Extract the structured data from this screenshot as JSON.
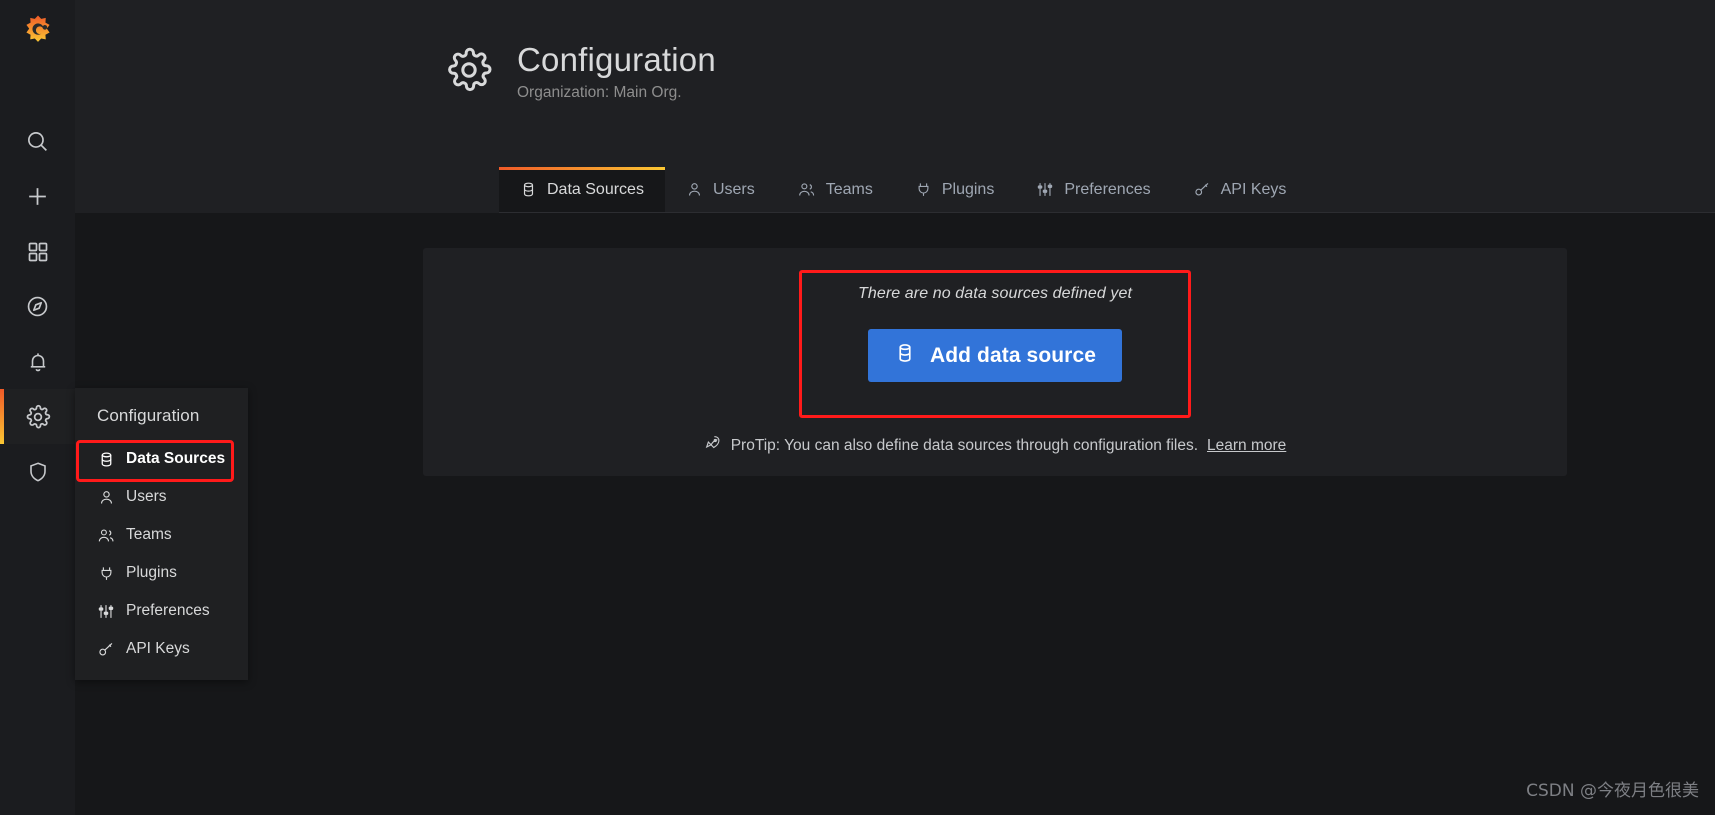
{
  "app": {
    "brand_icon": "grafana-logo-icon",
    "background": "#161719",
    "panel_background": "#1f2023",
    "accent_gradient_start": "#f05a28",
    "accent_gradient_end": "#fbc733",
    "primary_button_color": "#3274d9",
    "highlight_box_color": "#ff1a1a"
  },
  "sidebar": {
    "items": [
      {
        "name": "search-icon",
        "label": "Search",
        "active": false
      },
      {
        "name": "plus-icon",
        "label": "Create",
        "active": false
      },
      {
        "name": "dashboards-icon",
        "label": "Dashboards",
        "active": false
      },
      {
        "name": "compass-icon",
        "label": "Explore",
        "active": false
      },
      {
        "name": "bell-icon",
        "label": "Alerting",
        "active": false
      },
      {
        "name": "gear-icon",
        "label": "Configuration",
        "active": true
      },
      {
        "name": "shield-icon",
        "label": "Server Admin",
        "active": false
      }
    ]
  },
  "flyout": {
    "title": "Configuration",
    "items": [
      {
        "label": "Data Sources",
        "icon": "database-icon",
        "highlighted": true
      },
      {
        "label": "Users",
        "icon": "user-icon",
        "highlighted": false
      },
      {
        "label": "Teams",
        "icon": "users-icon",
        "highlighted": false
      },
      {
        "label": "Plugins",
        "icon": "plug-icon",
        "highlighted": false
      },
      {
        "label": "Preferences",
        "icon": "sliders-icon",
        "highlighted": false
      },
      {
        "label": "API Keys",
        "icon": "key-icon",
        "highlighted": false
      }
    ]
  },
  "header": {
    "icon": "gear-icon",
    "title": "Configuration",
    "subtitle": "Organization: Main Org."
  },
  "tabs": [
    {
      "label": "Data Sources",
      "icon": "database-icon",
      "active": true
    },
    {
      "label": "Users",
      "icon": "user-icon",
      "active": false
    },
    {
      "label": "Teams",
      "icon": "users-icon",
      "active": false
    },
    {
      "label": "Plugins",
      "icon": "plug-icon",
      "active": false
    },
    {
      "label": "Preferences",
      "icon": "sliders-icon",
      "active": false
    },
    {
      "label": "API Keys",
      "icon": "key-icon",
      "active": false
    }
  ],
  "main": {
    "empty_message": "There are no data sources defined yet",
    "add_button_label": "Add data source",
    "add_button_icon": "database-icon",
    "protip_icon": "rocket-icon",
    "protip_text": "ProTip: You can also define data sources through configuration files.",
    "protip_link": "Learn more"
  },
  "watermark": {
    "text": "CSDN @今夜月色很美"
  }
}
